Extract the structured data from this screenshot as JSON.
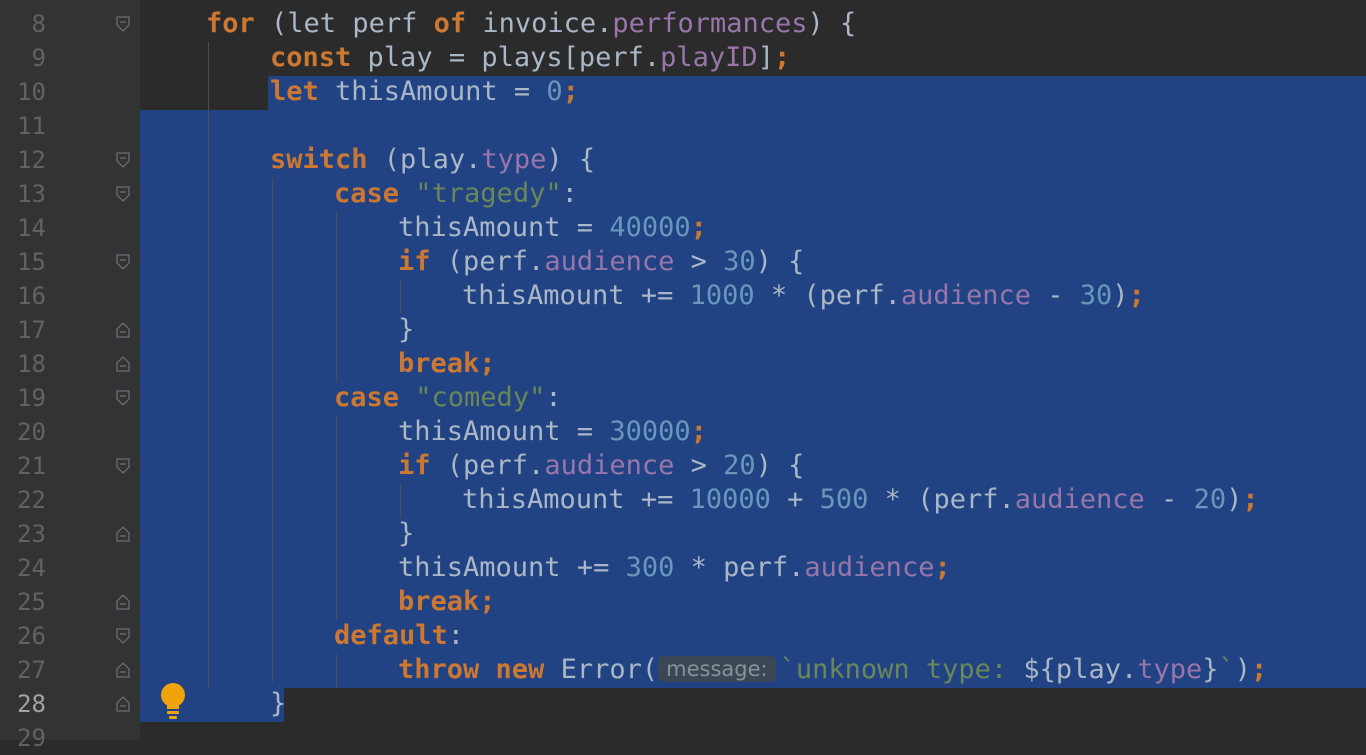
{
  "editor": {
    "current_line": 28,
    "lines": [
      {
        "n": "8",
        "i": 0,
        "fold": "open",
        "t": [
          [
            "kw",
            "for "
          ],
          [
            "",
            "(let "
          ],
          [
            "",
            "perf "
          ],
          [
            "kw",
            "of "
          ],
          [
            "",
            "invoice."
          ],
          [
            "prop",
            "performances"
          ],
          [
            "",
            ") {"
          ]
        ]
      },
      {
        "n": "9",
        "i": 1,
        "fold": "",
        "t": [
          [
            "kw",
            "const "
          ],
          [
            "",
            "play = plays[perf."
          ],
          [
            "prop",
            "playID"
          ],
          [
            "",
            "]"
          ],
          [
            "kw",
            ";"
          ]
        ]
      },
      {
        "n": "10",
        "i": 1,
        "fold": "",
        "t": [
          [
            "kw",
            "let "
          ],
          [
            "",
            "thisAmount = "
          ],
          [
            "num",
            "0"
          ],
          [
            "kw",
            ";"
          ]
        ]
      },
      {
        "n": "11",
        "i": 1,
        "fold": "",
        "t": []
      },
      {
        "n": "12",
        "i": 1,
        "fold": "open",
        "t": [
          [
            "kw",
            "switch "
          ],
          [
            "",
            "(play."
          ],
          [
            "prop",
            "type"
          ],
          [
            "",
            ") {"
          ]
        ]
      },
      {
        "n": "13",
        "i": 2,
        "fold": "open",
        "t": [
          [
            "kw",
            "case "
          ],
          [
            "str",
            "\"tragedy\""
          ],
          [
            "",
            ":"
          ]
        ]
      },
      {
        "n": "14",
        "i": 3,
        "fold": "",
        "t": [
          [
            "",
            "thisAmount = "
          ],
          [
            "num",
            "40000"
          ],
          [
            "kw",
            ";"
          ]
        ]
      },
      {
        "n": "15",
        "i": 3,
        "fold": "open",
        "t": [
          [
            "kw",
            "if "
          ],
          [
            "",
            "(perf."
          ],
          [
            "prop",
            "audience"
          ],
          [
            "",
            " > "
          ],
          [
            "num",
            "30"
          ],
          [
            "",
            ") {"
          ]
        ]
      },
      {
        "n": "16",
        "i": 4,
        "fold": "",
        "t": [
          [
            "",
            "thisAmount += "
          ],
          [
            "num",
            "1000"
          ],
          [
            "",
            " * (perf."
          ],
          [
            "prop",
            "audience"
          ],
          [
            "",
            " - "
          ],
          [
            "num",
            "30"
          ],
          [
            "",
            ")"
          ],
          [
            "kw",
            ";"
          ]
        ]
      },
      {
        "n": "17",
        "i": 3,
        "fold": "close",
        "t": [
          [
            "",
            "}"
          ]
        ]
      },
      {
        "n": "18",
        "i": 3,
        "fold": "close",
        "t": [
          [
            "kw",
            "break;"
          ]
        ]
      },
      {
        "n": "19",
        "i": 2,
        "fold": "open",
        "t": [
          [
            "kw",
            "case "
          ],
          [
            "str",
            "\"comedy\""
          ],
          [
            "",
            ":"
          ]
        ]
      },
      {
        "n": "20",
        "i": 3,
        "fold": "",
        "t": [
          [
            "",
            "thisAmount = "
          ],
          [
            "num",
            "30000"
          ],
          [
            "kw",
            ";"
          ]
        ]
      },
      {
        "n": "21",
        "i": 3,
        "fold": "open",
        "t": [
          [
            "kw",
            "if "
          ],
          [
            "",
            "(perf."
          ],
          [
            "prop",
            "audience"
          ],
          [
            "",
            " > "
          ],
          [
            "num",
            "20"
          ],
          [
            "",
            ") {"
          ]
        ]
      },
      {
        "n": "22",
        "i": 4,
        "fold": "",
        "t": [
          [
            "",
            "thisAmount += "
          ],
          [
            "num",
            "10000"
          ],
          [
            "",
            " + "
          ],
          [
            "num",
            "500"
          ],
          [
            "",
            " * (perf."
          ],
          [
            "prop",
            "audience"
          ],
          [
            "",
            " - "
          ],
          [
            "num",
            "20"
          ],
          [
            "",
            ")"
          ],
          [
            "kw",
            ";"
          ]
        ]
      },
      {
        "n": "23",
        "i": 3,
        "fold": "close",
        "t": [
          [
            "",
            "}"
          ]
        ]
      },
      {
        "n": "24",
        "i": 3,
        "fold": "",
        "t": [
          [
            "",
            "thisAmount += "
          ],
          [
            "num",
            "300"
          ],
          [
            "",
            " * perf."
          ],
          [
            "prop",
            "audience"
          ],
          [
            "kw",
            ";"
          ]
        ]
      },
      {
        "n": "25",
        "i": 3,
        "fold": "close",
        "t": [
          [
            "kw",
            "break;"
          ]
        ]
      },
      {
        "n": "26",
        "i": 2,
        "fold": "open",
        "t": [
          [
            "kw",
            "default"
          ],
          [
            "",
            ":"
          ]
        ]
      },
      {
        "n": "27",
        "i": 3,
        "fold": "close",
        "t": [
          [
            "kw",
            "throw "
          ],
          [
            "kw",
            "new "
          ],
          [
            "",
            "Error("
          ],
          [
            "hint",
            "message:"
          ],
          [
            "str",
            "`unknown type: "
          ],
          [
            "",
            "${play."
          ],
          [
            "prop",
            "type"
          ],
          [
            "",
            "}"
          ],
          [
            "str",
            "`"
          ],
          [
            "",
            ")"
          ],
          [
            "kw",
            ";"
          ]
        ]
      },
      {
        "n": "28",
        "i": 1,
        "fold": "close",
        "t": [
          [
            "",
            "}"
          ]
        ]
      },
      {
        "n": "29",
        "i": 0,
        "fold": "",
        "t": []
      }
    ]
  },
  "colors": {
    "background": "#2b2b2b",
    "gutter": "#313335",
    "selection": "#214283",
    "keyword": "#cc7832",
    "string": "#6a8759",
    "number": "#6897bb",
    "property": "#9876aa",
    "text": "#a9b7c6"
  },
  "icons": {
    "intention": "lightbulb-icon"
  }
}
